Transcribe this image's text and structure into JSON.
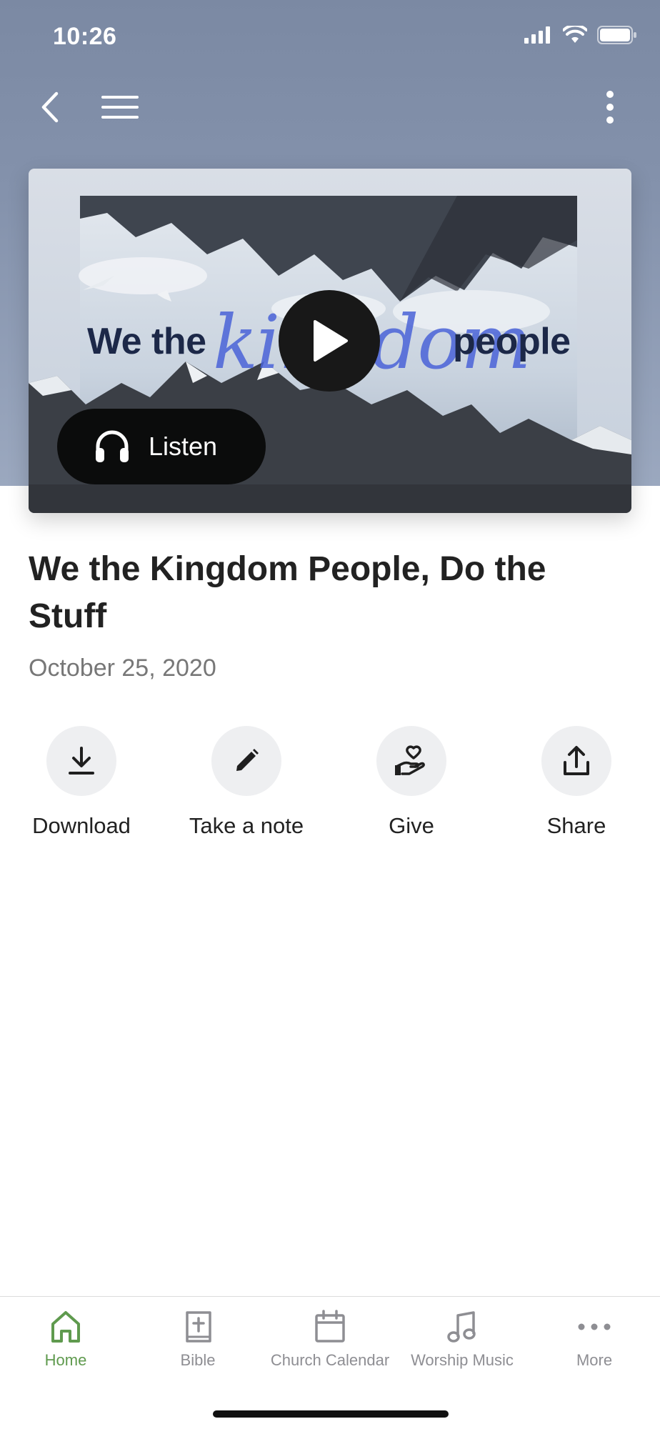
{
  "status_bar": {
    "time": "10:26"
  },
  "hero": {
    "artwork_text": {
      "we_the": "We the",
      "kingdom": "kingdom",
      "people": "people"
    },
    "listen_label": "Listen"
  },
  "content": {
    "title": "We the Kingdom People, Do the Stuff",
    "date": "October 25, 2020"
  },
  "actions": [
    {
      "label": "Download",
      "icon": "download-icon"
    },
    {
      "label": "Take a note",
      "icon": "pencil-icon"
    },
    {
      "label": "Give",
      "icon": "heart-hand-icon"
    },
    {
      "label": "Share",
      "icon": "share-icon"
    }
  ],
  "tabs": [
    {
      "label": "Home",
      "icon": "home-icon",
      "active": true
    },
    {
      "label": "Bible",
      "icon": "bible-icon",
      "active": false
    },
    {
      "label": "Church Calendar",
      "icon": "calendar-icon",
      "active": false
    },
    {
      "label": "Worship Music",
      "icon": "music-note-icon",
      "active": false
    },
    {
      "label": "More",
      "icon": "ellipsis-icon",
      "active": false
    }
  ],
  "colors": {
    "accent": "#5f9a4e",
    "hero_bg": "#8492ac",
    "tab_inactive": "#8e8e93"
  }
}
